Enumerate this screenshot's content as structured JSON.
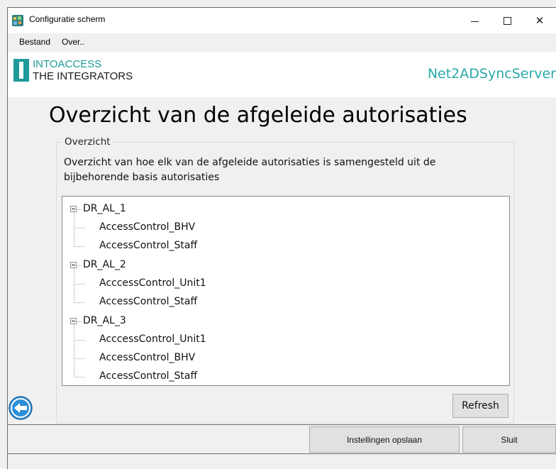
{
  "window": {
    "title": "Configuratie scherm",
    "controls": {
      "minimize_icon": "minimize-icon",
      "maximize_icon": "maximize-icon",
      "close_icon": "close-icon",
      "close_glyph": "✕"
    }
  },
  "menu": {
    "items": [
      "Bestand",
      "Over.."
    ]
  },
  "header": {
    "logo_line1": "INTOACCESS",
    "logo_line2": "THE INTEGRATORS",
    "app_name": "Net2ADSyncServer",
    "brand_color": "#1e9a9a"
  },
  "page": {
    "title": "Overzicht van de afgeleide autorisaties"
  },
  "overview": {
    "legend": "Overzicht",
    "description": "Overzicht van hoe elk van de afgeleide autorisaties is samengesteld uit de bijbehorende basis autorisaties",
    "tree": [
      {
        "label": "DR_AL_1",
        "expanded": true,
        "children": [
          "AccessControl_BHV",
          "AccessControl_Staff"
        ]
      },
      {
        "label": "DR_AL_2",
        "expanded": true,
        "children": [
          "AcccessControl_Unit1",
          "AccessControl_Staff"
        ]
      },
      {
        "label": "DR_AL_3",
        "expanded": true,
        "children": [
          "AcccessControl_Unit1",
          "AccessControl_BHV",
          "AccessControl_Staff"
        ]
      }
    ],
    "refresh_label": "Refresh"
  },
  "footer": {
    "save_label": "Instellingen opslaan",
    "close_label": "Sluit",
    "back_icon": "back-arrow-icon",
    "back_color": "#2e8fd6"
  }
}
